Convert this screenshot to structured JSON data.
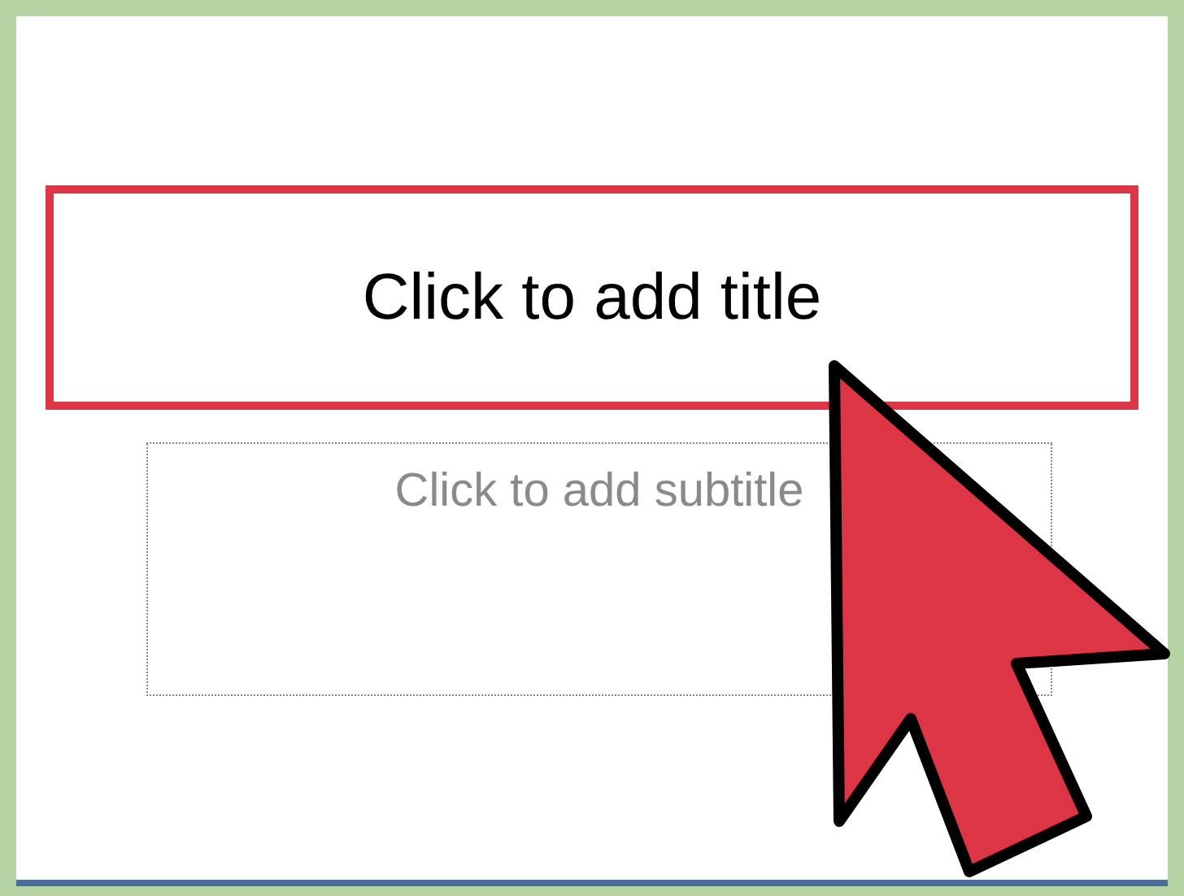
{
  "slide": {
    "title_placeholder": {
      "text": "Click to add title",
      "selected": true
    },
    "subtitle_placeholder": {
      "text": "Click to add subtitle",
      "selected": false
    }
  }
}
